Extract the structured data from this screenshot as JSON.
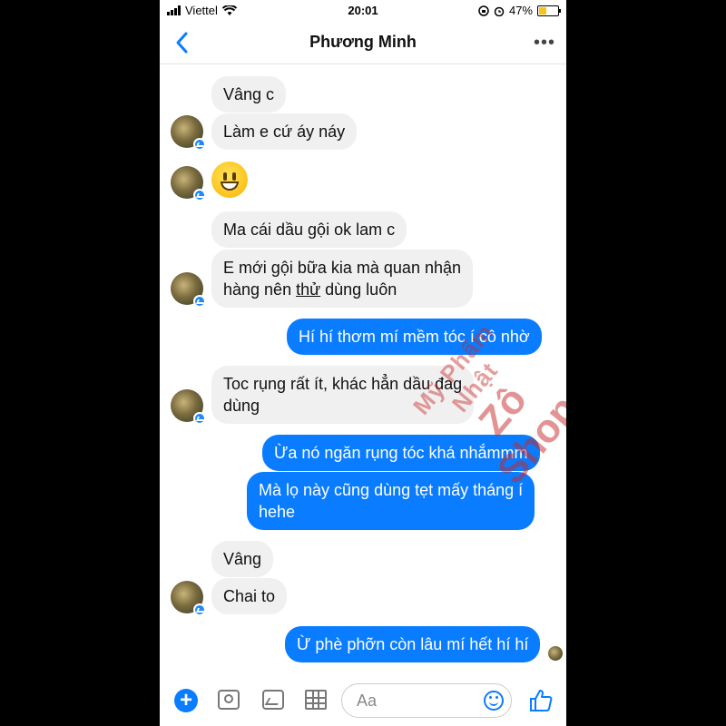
{
  "status_bar": {
    "carrier": "Viettel",
    "time": "20:01",
    "battery": "47%",
    "battery_level": 0.47
  },
  "header": {
    "title": "Phương Minh",
    "back_icon": "chevron-left-icon",
    "more_icon": "more-dots-icon"
  },
  "messages": [
    {
      "from": "them",
      "text": "Vâng c"
    },
    {
      "from": "them",
      "text": "Làm e cứ áy náy"
    },
    {
      "from": "them",
      "emoji": "grinning-face"
    },
    {
      "from": "them",
      "text": "Ma cái dầu gội ok lam c"
    },
    {
      "from": "them",
      "line1": "E mới gội bữa kia mà quan nhận",
      "line2_pre": "hàng nên ",
      "line2_u": "thử",
      "line2_post": " dùng luôn"
    },
    {
      "from": "me",
      "text": "Hí hí thơm mí mềm tóc í cô nhờ"
    },
    {
      "from": "them",
      "line1": "Toc rụng rất ít, khác hẳn dầu đag",
      "line2": "dùng"
    },
    {
      "from": "me",
      "text": "Ừa nó ngăn rụng tóc khá nhắmmm"
    },
    {
      "from": "me",
      "line1": "Mà lọ này cũng dùng tẹt mấy tháng í",
      "line2": "hehe"
    },
    {
      "from": "them",
      "text": "Vâng"
    },
    {
      "from": "them",
      "text": "Chai to"
    },
    {
      "from": "me",
      "text": "Ừ phè phỡn còn lâu mí hết hí hí"
    }
  ],
  "watermark": {
    "line1": "Mỹ Phẩm Nhật",
    "line2": "Zô Shop"
  },
  "composer": {
    "placeholder": "Aa",
    "icons": [
      "plus-icon",
      "camera-icon",
      "gallery-icon",
      "sticker-grid-icon",
      "emoji-icon",
      "like-icon"
    ]
  },
  "colors": {
    "accent": "#0a7cff",
    "incoming_bubble": "#f0f0f0",
    "watermark": "#c82828"
  }
}
